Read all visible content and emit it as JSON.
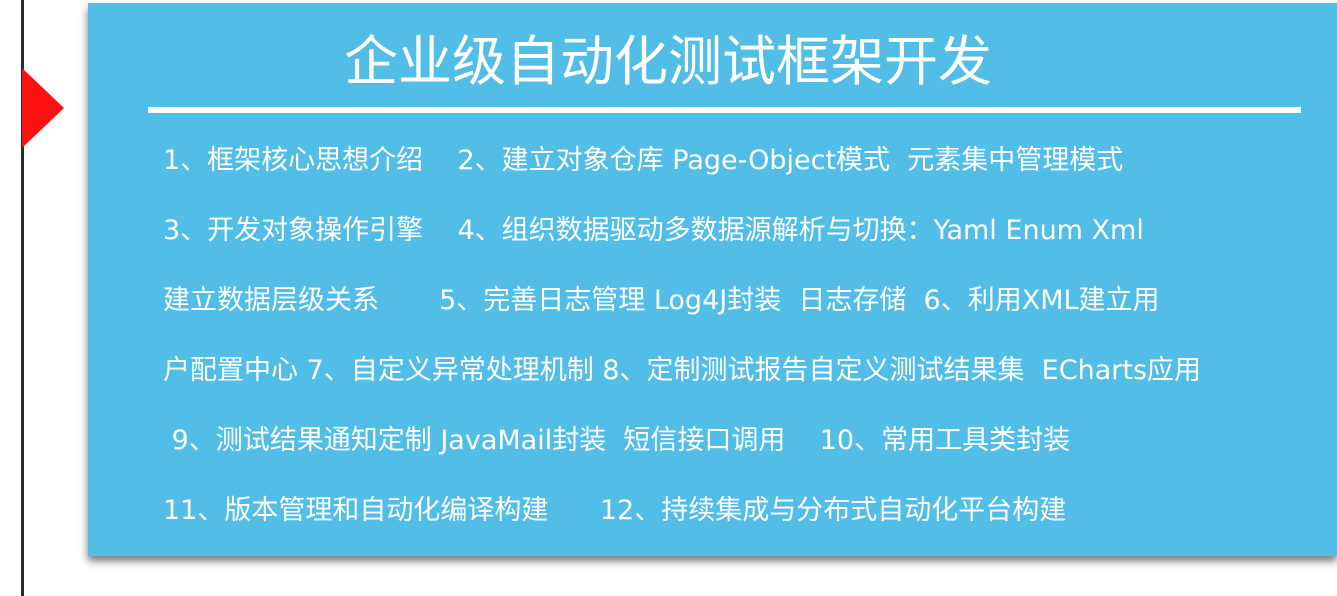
{
  "banner": {
    "title": "企业级自动化测试框架开发",
    "lines": [
      "1、框架核心思想介绍    2、建立对象仓库 Page-Object模式  元素集中管理模式",
      "3、开发对象操作引擎    4、组织数据驱动多数据源解析与切换：Yaml Enum Xml",
      "建立数据层级关系       5、完善日志管理 Log4J封装  日志存储  6、利用XML建立用",
      "户配置中心 7、自定义异常处理机制 8、定制测试报告自定义测试结果集  ECharts应用",
      " 9、测试结果通知定制 JavaMail封装  短信接口调用    10、常用工具类封装",
      "11、版本管理和自动化编译构建      12、持续集成与分布式自动化平台构建"
    ]
  },
  "colors": {
    "panel_background": "#52bde6",
    "text": "#ffffff",
    "arrow": "#ff1111",
    "vertical_line": "#2b2b2b"
  }
}
